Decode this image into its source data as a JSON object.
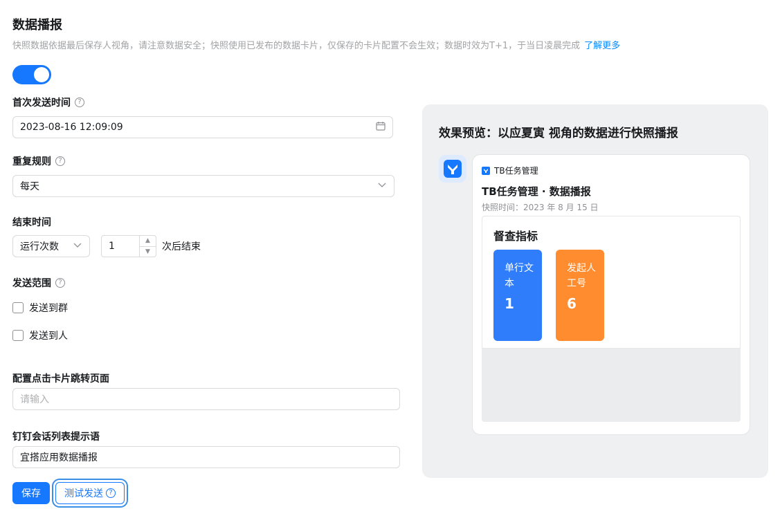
{
  "header": {
    "title": "数据播报",
    "description": "快照数据依据最后保存人视角，请注意数据安全；快照使用已发布的数据卡片，仅保存的卡片配置不会生效；数据时效为T+1，于当日凌晨完成",
    "learn_more": "了解更多"
  },
  "toggle": {
    "state": "on",
    "color": "#1677ff"
  },
  "first_send": {
    "label": "首次发送时间",
    "value": "2023-08-16 12:09:09"
  },
  "repeat": {
    "label": "重复规则",
    "value": "每天"
  },
  "end": {
    "label": "结束时间",
    "mode": "运行次数",
    "count": "1",
    "suffix": "次后结束"
  },
  "scope": {
    "label": "发送范围",
    "options": [
      {
        "label": "发送到群",
        "checked": false
      },
      {
        "label": "发送到人",
        "checked": false
      }
    ]
  },
  "jump": {
    "label": "配置点击卡片跳转页面",
    "placeholder": "请输入"
  },
  "hint": {
    "label": "钉钉会话列表提示语",
    "value": "宜搭应用数据播报"
  },
  "buttons": {
    "save": "保存",
    "test_send": "测试发送"
  },
  "preview": {
    "title": "效果预览：以应夏寅 视角的数据进行快照播报",
    "app_name": "TB任务管理",
    "card_title": "TB任务管理 · 数据播报",
    "snapshot_time": "快照时间：2023 年 8 月 15 日",
    "section_title": "督查指标",
    "metrics": [
      {
        "label": "单行文本",
        "value": "1",
        "color": "#2f7dfa"
      },
      {
        "label": "发起人工号",
        "value": "6",
        "color": "#ff8c2e"
      }
    ]
  }
}
